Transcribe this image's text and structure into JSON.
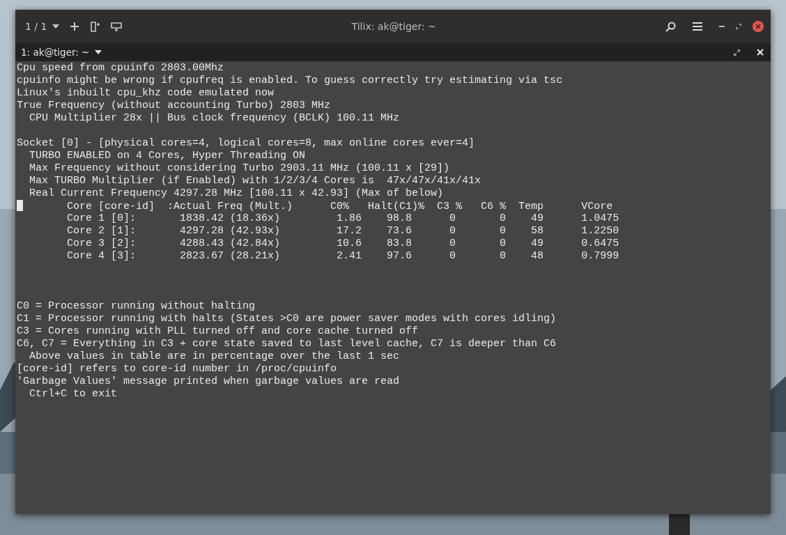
{
  "window": {
    "title": "Tilix: ak@tiger: ~",
    "session_counter": "1 / 1"
  },
  "terminal_tab": {
    "title": "1: ak@tiger: ~"
  },
  "terminal": {
    "cpu_info": [
      "Cpu speed from cpuinfo 2803.00Mhz",
      "cpuinfo might be wrong if cpufreq is enabled. To guess correctly try estimating via tsc",
      "Linux's inbuilt cpu_khz code emulated now",
      "True Frequency (without accounting Turbo) 2803 MHz",
      "  CPU Multiplier 28x || Bus clock frequency (BCLK) 100.11 MHz"
    ],
    "socket": [
      "Socket [0] - [physical cores=4, logical cores=8, max online cores ever=4]",
      "  TURBO ENABLED on 4 Cores, Hyper Threading ON",
      "  Max Frequency without considering Turbo 2903.11 MHz (100.11 x [29])",
      "  Max TURBO Multiplier (if Enabled) with 1/2/3/4 Cores is  47x/47x/41x/41x",
      "  Real Current Frequency 4297.28 MHz [100.11 x 42.93] (Max of below)"
    ],
    "table": {
      "cursor": true,
      "header": "       Core [core-id]  :Actual Freq (Mult.)      C0%   Halt(C1)%  C3 %   C6 %  Temp      VCore",
      "rows": [
        "        Core 1 [0]:       1838.42 (18.36x)         1.86    98.8      0       0    49      1.0475",
        "        Core 2 [1]:       4297.28 (42.93x)         17.2    73.6      0       0    58      1.2250",
        "        Core 3 [2]:       4288.43 (42.84x)         10.6    83.8      0       0    49      0.6475",
        "        Core 4 [3]:       2823.67 (28.21x)         2.41    97.6      0       0    48      0.7999"
      ]
    },
    "legend": [
      "C0 = Processor running without halting",
      "C1 = Processor running with halts (States >C0 are power saver modes with cores idling)",
      "C3 = Cores running with PLL turned off and core cache turned off",
      "C6, C7 = Everything in C3 + core state saved to last level cache, C7 is deeper than C6",
      "  Above values in table are in percentage over the last 1 sec",
      "[core-id] refers to core-id number in /proc/cpuinfo",
      "'Garbage Values' message printed when garbage values are read",
      "  Ctrl+C to exit"
    ]
  }
}
